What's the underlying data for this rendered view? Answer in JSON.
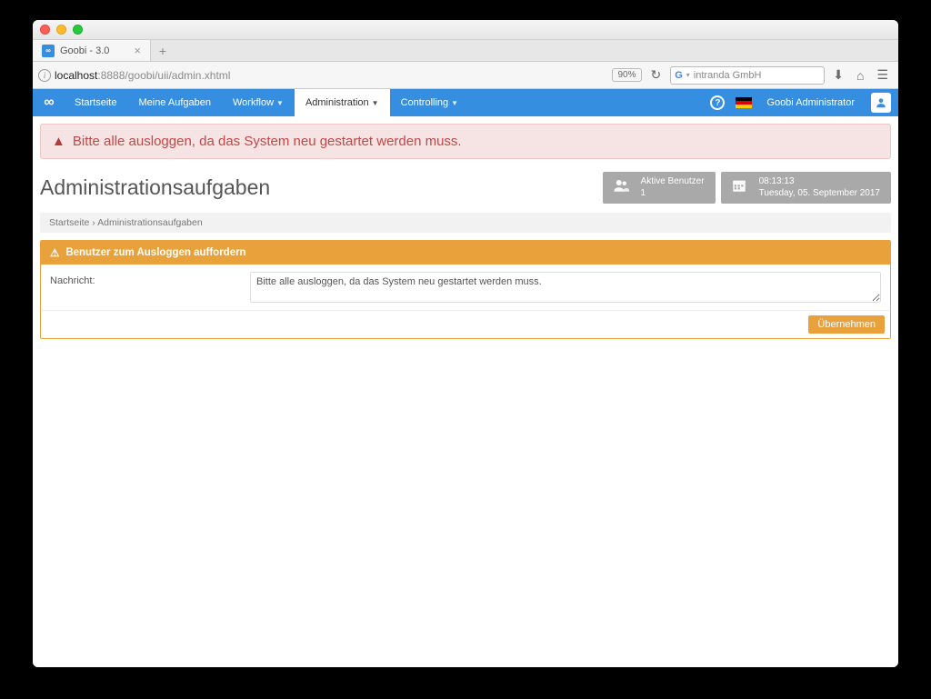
{
  "browser": {
    "tab_title": "Goobi - 3.0",
    "url_prefix": "localhost",
    "url_rest": ":8888/goobi/uii/admin.xhtml",
    "zoom": "90%",
    "search_placeholder": "intranda GmbH"
  },
  "nav": {
    "items": [
      {
        "label": "Startseite"
      },
      {
        "label": "Meine Aufgaben"
      },
      {
        "label": "Workflow"
      },
      {
        "label": "Administration"
      },
      {
        "label": "Controlling"
      }
    ],
    "user": "Goobi Administrator"
  },
  "alert": {
    "text": "Bitte alle ausloggen, da das System neu gestartet werden muss."
  },
  "page": {
    "title": "Administrationsaufgaben",
    "crumb_home": "Startseite",
    "crumb_sep": " › ",
    "crumb_current": "Administrationsaufgaben"
  },
  "stats": {
    "users_label": "Aktive Benutzer",
    "users_count": "1",
    "time": "08:13:13",
    "date": "Tuesday, 05. September 2017"
  },
  "panel": {
    "title": "Benutzer zum Ausloggen auffordern",
    "field_label": "Nachricht:",
    "message_value": "Bitte alle ausloggen, da das System neu gestartet werden muss.",
    "submit": "Übernehmen"
  }
}
